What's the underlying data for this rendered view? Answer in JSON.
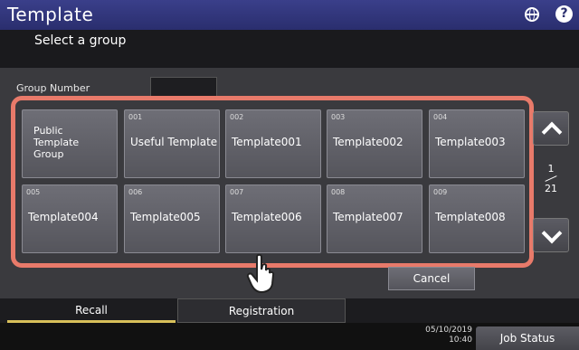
{
  "header": {
    "title": "Template",
    "globe_icon": "globe-icon",
    "help_icon": "help-icon",
    "help_glyph": "?"
  },
  "subheader": {
    "text": "Select a group"
  },
  "group_number": {
    "label": "Group Number",
    "value": ""
  },
  "groups": [
    {
      "num": "",
      "name": "Public Template Group"
    },
    {
      "num": "001",
      "name": "Useful Template"
    },
    {
      "num": "002",
      "name": "Template001"
    },
    {
      "num": "003",
      "name": "Template002"
    },
    {
      "num": "004",
      "name": "Template003"
    },
    {
      "num": "005",
      "name": "Template004"
    },
    {
      "num": "006",
      "name": "Template005"
    },
    {
      "num": "007",
      "name": "Template006"
    },
    {
      "num": "008",
      "name": "Template007"
    },
    {
      "num": "009",
      "name": "Template008"
    }
  ],
  "pager": {
    "current": "1",
    "total": "21"
  },
  "cancel_label": "Cancel",
  "tabs": {
    "recall": "Recall",
    "registration": "Registration"
  },
  "footer": {
    "date": "05/10/2019",
    "time": "10:40",
    "job_status": "Job Status"
  },
  "colors": {
    "highlight": "#e87a6a",
    "active_tab": "#d8c05a",
    "title_bar": "#2a2e6e"
  }
}
